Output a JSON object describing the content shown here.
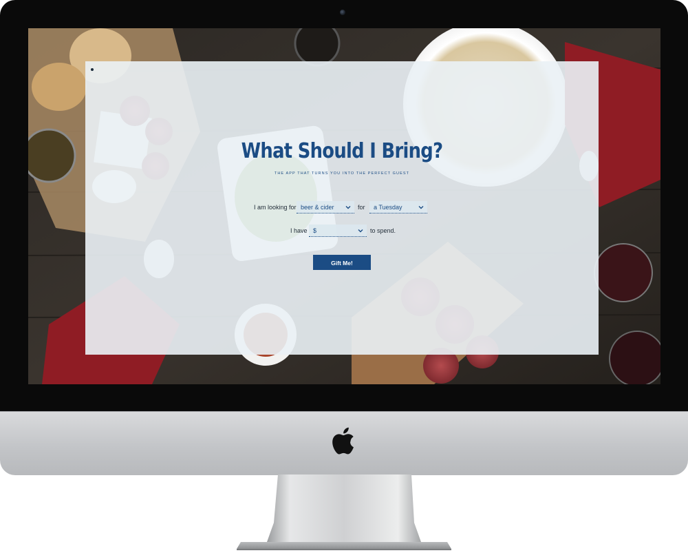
{
  "app": {
    "title": "What Should I Bring?",
    "subtitle": "THE APP THAT TURNS YOU INTO THE PERFECT GUEST"
  },
  "form": {
    "looking_for_label": "I am looking for",
    "category_select": {
      "value": "beer & cider",
      "icon": "chevron-down-icon"
    },
    "for_label": "for",
    "occasion_select": {
      "value": "a Tuesday",
      "icon": "chevron-down-icon"
    },
    "have_label": "I have",
    "budget_select": {
      "value": "$",
      "icon": "chevron-down-icon"
    },
    "spend_label": "to spend.",
    "submit_label": "Gift Me!"
  },
  "colors": {
    "brand": "#1b4c84",
    "panel": "#eaf1f5",
    "bezel": "#0a0a0a",
    "aluminum": "#c7c9cc"
  },
  "device": {
    "logo_icon": "apple-logo-icon",
    "camera_icon": "camera-icon"
  }
}
